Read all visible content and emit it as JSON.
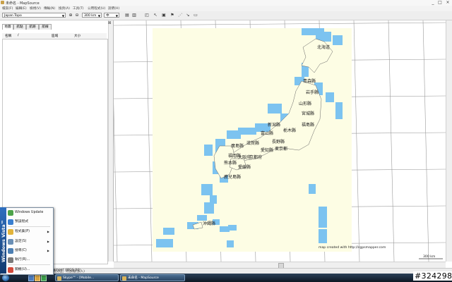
{
  "window": {
    "title": "未命名 - MapSource",
    "controls": [
      "_",
      "□",
      "×"
    ]
  },
  "menu": [
    "檔案(F)",
    "編輯(E)",
    "檢視(V)",
    "傳輸(N)",
    "換頁(A)",
    "工具(T)",
    "公用程式(U)",
    "說明(H)"
  ],
  "toolbar": {
    "map_product": "Japan Topo",
    "zoom_scale": "300 km",
    "third_combo": "中"
  },
  "left_panel": {
    "tabs": [
      "地圖",
      "航點",
      "航跡",
      "航線"
    ],
    "columns": [
      "名稱",
      "/",
      "區域",
      "大小"
    ]
  },
  "map": {
    "prefectures": [
      "北海道",
      "青森縣",
      "岩手縣",
      "山形縣",
      "宮城縣",
      "福島縣",
      "新潟縣",
      "栃木縣",
      "富山縣",
      "長野縣",
      "東京都",
      "愛知縣",
      "滋賀縣",
      "廣島縣",
      "京都府",
      "大阪府",
      "福岡縣",
      "熊本縣",
      "愛媛縣",
      "鹿兒島縣",
      "沖繩縣"
    ],
    "credit": "map created with http://cgpsmapper.com",
    "scale": "300 km"
  },
  "status": {
    "left": "mment (WGS 84)",
    "hint": "劃分區，附加點(加入)"
  },
  "start_menu": {
    "items": [
      {
        "label": "Windows Update",
        "icon": "windows-update-icon",
        "color": "#4da34a",
        "submenu": false
      },
      {
        "label": "預設程式",
        "icon": "default-programs-icon",
        "color": "#3a7fd0",
        "submenu": false
      },
      {
        "label": "程式集(P)",
        "icon": "programs-icon",
        "color": "#e2b33a",
        "submenu": true
      },
      {
        "label": "設定(S)",
        "icon": "settings-icon",
        "color": "#6a8fb5",
        "submenu": true
      },
      {
        "label": "搜尋(C)",
        "icon": "search-icon",
        "color": "#4c7fb3",
        "submenu": true
      },
      {
        "label": "執行(R)...",
        "icon": "run-icon",
        "color": "#7a7a7a",
        "submenu": false
      },
      {
        "label": "關機(U)...",
        "icon": "shutdown-icon",
        "color": "#d24a3a",
        "submenu": false
      }
    ],
    "brand": "Windows Vista™"
  },
  "taskbar": {
    "tasks": [
      "Skype™ - [Mobile...",
      "未命名 - MapSource"
    ]
  },
  "watermark": "#324298",
  "colors": {
    "paper": "#fdfde4",
    "sea_tile": "#7cc3f0",
    "grid": "#9a9a9a",
    "land": "#fdfde4"
  }
}
